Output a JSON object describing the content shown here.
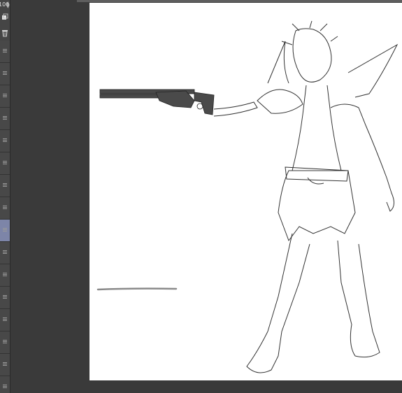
{
  "layer_panel": {
    "opacity_value": "100",
    "tools": [
      {
        "name": "layer-property-icon"
      },
      {
        "name": "trash-icon"
      }
    ],
    "layers": [
      {
        "active": false
      },
      {
        "active": false
      },
      {
        "active": false
      },
      {
        "active": false
      },
      {
        "active": false
      },
      {
        "active": false
      },
      {
        "active": false
      },
      {
        "active": false
      },
      {
        "active": true
      },
      {
        "active": false
      },
      {
        "active": false
      },
      {
        "active": false
      },
      {
        "active": false
      },
      {
        "active": false
      },
      {
        "active": false
      },
      {
        "active": false
      }
    ]
  },
  "canvas": {
    "background": "#ffffff",
    "artwork": "lineart-character-with-shotgun",
    "shotgun_color": "#4a4a4a",
    "stroke_color": "#8a8a8a"
  },
  "colors": {
    "panel_bg": "#4a4a4a",
    "active_layer": "#7d85a8",
    "workspace": "#3a3a3a"
  }
}
